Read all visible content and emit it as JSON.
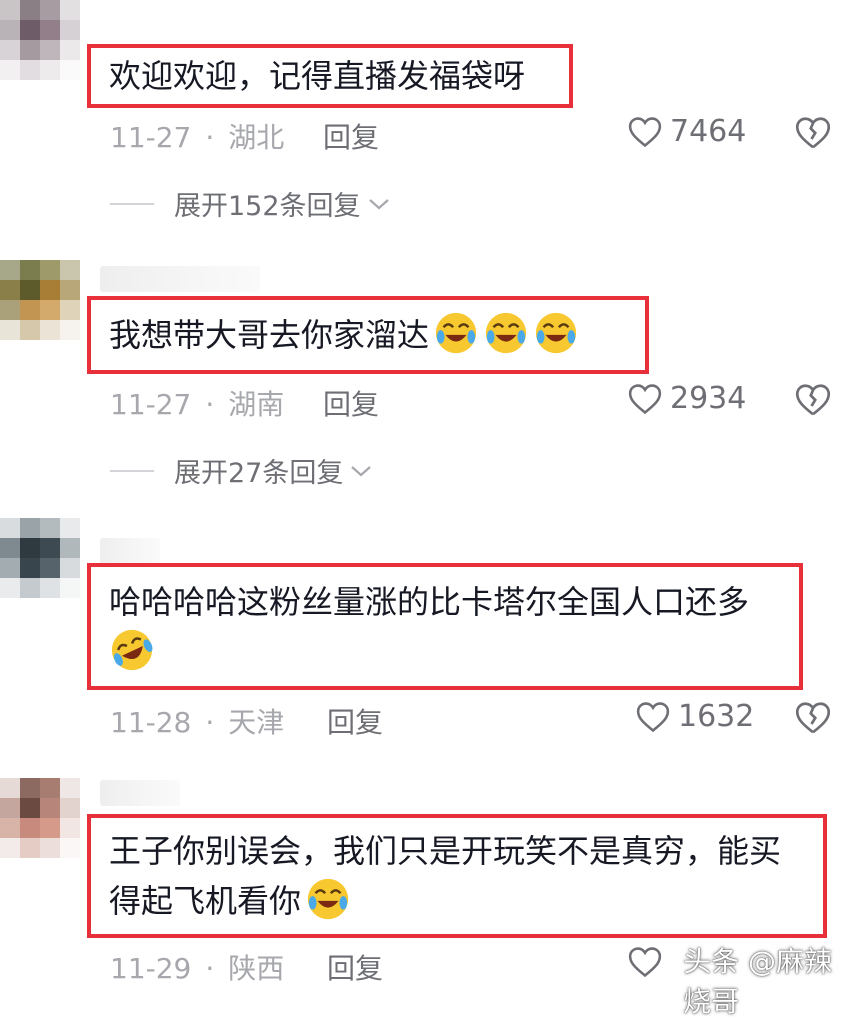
{
  "comments": [
    {
      "lines": [
        "欢迎欢迎，记得直播发福袋呀"
      ],
      "emojis": [],
      "date": "11-27",
      "location": "湖北",
      "reply_label": "回复",
      "likes": "7464",
      "expand": "展开152条回复"
    },
    {
      "lines": [
        "我想带大哥去你家溜达"
      ],
      "emojis": [
        "crying-laughing-emoji",
        "crying-laughing-emoji",
        "crying-laughing-emoji"
      ],
      "date": "11-27",
      "location": "湖南",
      "reply_label": "回复",
      "likes": "2934",
      "expand": "展开27条回复"
    },
    {
      "lines": [
        "哈哈哈哈这粉丝量涨的比卡塔尔全国人口还多",
        ""
      ],
      "emojis": [
        "rolling-laughing-emoji"
      ],
      "date": "11-28",
      "location": "天津",
      "reply_label": "回复",
      "likes": "1632"
    },
    {
      "lines": [
        "王子你别误会，我们只是开玩笑不是真穷，能买",
        "得起飞机看你"
      ],
      "emojis": [
        "crying-laughing-emoji"
      ],
      "date": "11-29",
      "location": "陕西",
      "reply_label": "回复"
    }
  ],
  "watermark": {
    "text": "头条 @麻辣烧哥"
  },
  "colors": {
    "highlight_border": "#e8303a",
    "meta_text": "#a7a8ad",
    "secondary_text": "#6e6f75"
  }
}
